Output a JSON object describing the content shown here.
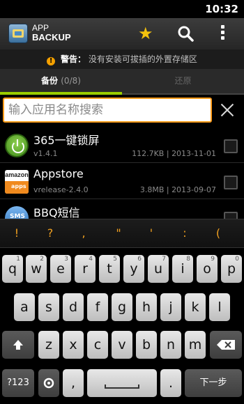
{
  "status_bar": {
    "time": "10:32"
  },
  "action_bar": {
    "app_name_line1": "APP",
    "app_name_line2": "BACKUP"
  },
  "warning": {
    "title": "警告：",
    "message": "没有安装可拔插的外置存储区"
  },
  "tabs": {
    "backup_label": "备份",
    "backup_count": "(0/8)",
    "restore_label": "还原"
  },
  "search": {
    "placeholder": "输入应用名称搜索"
  },
  "apps": [
    {
      "name": "365一键锁屏",
      "version": "v1.4.1",
      "size": "112.7KB",
      "date": "2013-11-01",
      "icon": "power-icon"
    },
    {
      "name": "Appstore",
      "version": "vrelease-2.4.0",
      "size": "3.8MB",
      "date": "2013-09-07",
      "icon": "amazon-appstore-icon"
    },
    {
      "name": "BBQ短信",
      "version": "",
      "size": "",
      "date": "",
      "icon": "sms-icon"
    }
  ],
  "amazon_icon": {
    "brand": "amazon",
    "sub": "apps"
  },
  "sms_icon": {
    "label": "SMS"
  },
  "keyboard": {
    "suggestions": [
      "!",
      "?",
      ",",
      "\"",
      "'",
      ":",
      "("
    ],
    "row1": [
      "q",
      "w",
      "e",
      "r",
      "t",
      "y",
      "u",
      "i",
      "o",
      "p"
    ],
    "row1_hints": [
      "1",
      "2",
      "3",
      "4",
      "5",
      "6",
      "7",
      "8",
      "9",
      "0"
    ],
    "row2": [
      "a",
      "s",
      "d",
      "f",
      "g",
      "h",
      "j",
      "k",
      "l"
    ],
    "row3": [
      "z",
      "x",
      "c",
      "v",
      "b",
      "n",
      "m"
    ],
    "symbols_key": "?123",
    "comma_key": ",",
    "period_key": ".",
    "next_key": "下一步"
  },
  "colors": {
    "accent_green": "#99cc00",
    "search_border": "#ff9c1a",
    "star": "#f4c20d",
    "suggestion_text": "#f0a020"
  }
}
